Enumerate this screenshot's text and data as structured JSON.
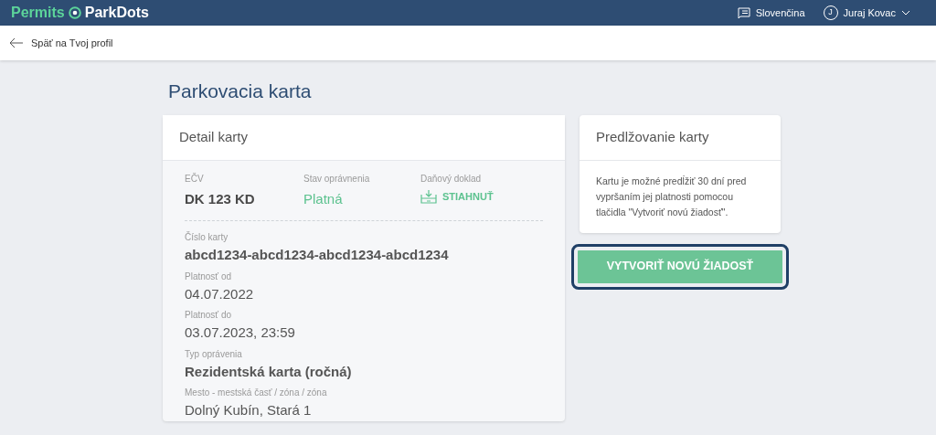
{
  "header": {
    "logo": {
      "left": "Permits",
      "right": "ParkDots"
    },
    "language": "Slovenčina",
    "user": {
      "initial": "J",
      "name": "Juraj Kovac"
    }
  },
  "back_link": "Späť na Tvoj profil",
  "page_title": "Parkovacia karta",
  "detail_card": {
    "title": "Detail karty",
    "summary": [
      {
        "kind": "plain",
        "label": "EČV",
        "value": "DK 123 KD"
      },
      {
        "kind": "status",
        "label": "Stav oprávnenia",
        "value": "Platná"
      },
      {
        "kind": "download",
        "label": "Daňový doklad",
        "value": "STIAHNUŤ"
      }
    ],
    "fields": [
      {
        "kind": "emphasis",
        "label": "Číslo karty",
        "value": "abcd1234-abcd1234-abcd1234-abcd1234"
      },
      {
        "kind": "plain",
        "label": "Platnosť od",
        "value": "04.07.2022"
      },
      {
        "kind": "plain",
        "label": "Platnosť do",
        "value": "03.07.2023, 23:59"
      },
      {
        "kind": "emphasis",
        "label": "Typ oprávenia",
        "value": "Rezidentská karta (ročná)"
      },
      {
        "kind": "plain",
        "label": "Mesto - mestská časť / zóna / zóna",
        "value": "Dolný Kubín, Stará 1"
      }
    ]
  },
  "renewal_card": {
    "title": "Predlžovanie karty",
    "text": "Kartu je možné predĺžiť 30 dní pred vypršaním jej platnosti pomocou tlačidla \"Vytvoriť novú žiadosť\".",
    "button": {
      "label": "VYTVORIŤ NOVÚ ŽIADOSŤ",
      "focused": true
    }
  }
}
